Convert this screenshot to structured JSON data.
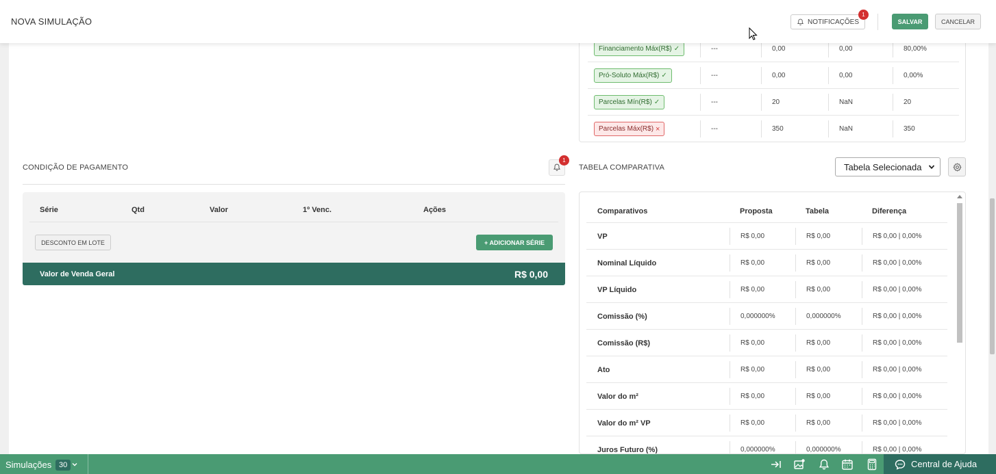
{
  "header": {
    "title": "NOVA SIMULAÇÃO",
    "notifications_label": "NOTIFICAÇÕES",
    "notifications_badge": "1",
    "save_label": "SALVAR",
    "cancel_label": "CANCELAR"
  },
  "limits": {
    "rows": [
      {
        "label": "Financiamento Máx(R$)",
        "status": "ok",
        "c1": "---",
        "c2": "0,00",
        "c3": "0,00",
        "c4": "80,00%"
      },
      {
        "label": "Pró-Soluto Máx(R$)",
        "status": "ok",
        "c1": "---",
        "c2": "0,00",
        "c3": "0,00",
        "c4": "0,00%"
      },
      {
        "label": "Parcelas Mín(R$)",
        "status": "ok",
        "c1": "---",
        "c2": "20",
        "c3": "NaN",
        "c4": "20"
      },
      {
        "label": "Parcelas Máx(R$)",
        "status": "error",
        "c1": "---",
        "c2": "350",
        "c3": "NaN",
        "c4": "350"
      }
    ]
  },
  "payment": {
    "title": "CONDIÇÃO DE PAGAMENTO",
    "bell_badge": "1",
    "columns": [
      "Série",
      "Qtd",
      "Valor",
      "1º Venc.",
      "Ações"
    ],
    "discount_button": "DESCONTO EM LOTE",
    "add_button": "+ ADICIONAR SÉRIE",
    "total_label": "Valor de Venda Geral",
    "total_value": "R$ 0,00"
  },
  "comparative": {
    "title": "TABELA COMPARATIVA",
    "select_value": "Tabela Selecionada",
    "columns": [
      "Comparativos",
      "Proposta",
      "Tabela",
      "Diferença"
    ],
    "rows": [
      {
        "name": "VP",
        "proposta": "R$ 0,00",
        "tabela": "R$ 0,00",
        "diferenca": "R$ 0,00 | 0,00%"
      },
      {
        "name": "Nominal Líquido",
        "proposta": "R$ 0,00",
        "tabela": "R$ 0,00",
        "diferenca": "R$ 0,00 | 0,00%"
      },
      {
        "name": "VP Líquido",
        "proposta": "R$ 0,00",
        "tabela": "R$ 0,00",
        "diferenca": "R$ 0,00 | 0,00%"
      },
      {
        "name": "Comissão (%)",
        "proposta": "0,000000%",
        "tabela": "0,000000%",
        "diferenca": "R$ 0,00 | 0,00%"
      },
      {
        "name": "Comissão (R$)",
        "proposta": "R$ 0,00",
        "tabela": "R$ 0,00",
        "diferenca": "R$ 0,00 | 0,00%"
      },
      {
        "name": "Ato",
        "proposta": "R$ 0,00",
        "tabela": "R$ 0,00",
        "diferenca": "R$ 0,00 | 0,00%"
      },
      {
        "name": "Valor do m²",
        "proposta": "R$ 0,00",
        "tabela": "R$ 0,00",
        "diferenca": "R$ 0,00 | 0,00%"
      },
      {
        "name": "Valor do m² VP",
        "proposta": "R$ 0,00",
        "tabela": "R$ 0,00",
        "diferenca": "R$ 0,00 | 0,00%"
      },
      {
        "name": "Juros Futuro (%)",
        "proposta": "0,000000%",
        "tabela": "0,000000%",
        "diferenca": "R$ 0,00 | 0,00%"
      }
    ]
  },
  "footer": {
    "simulations_label": "Simulações",
    "simulations_count": "30",
    "help_label": "Central de Ajuda"
  },
  "colors": {
    "accent": "#4a9b73",
    "dark_accent": "#2e6d60",
    "error": "#d32f2f"
  }
}
